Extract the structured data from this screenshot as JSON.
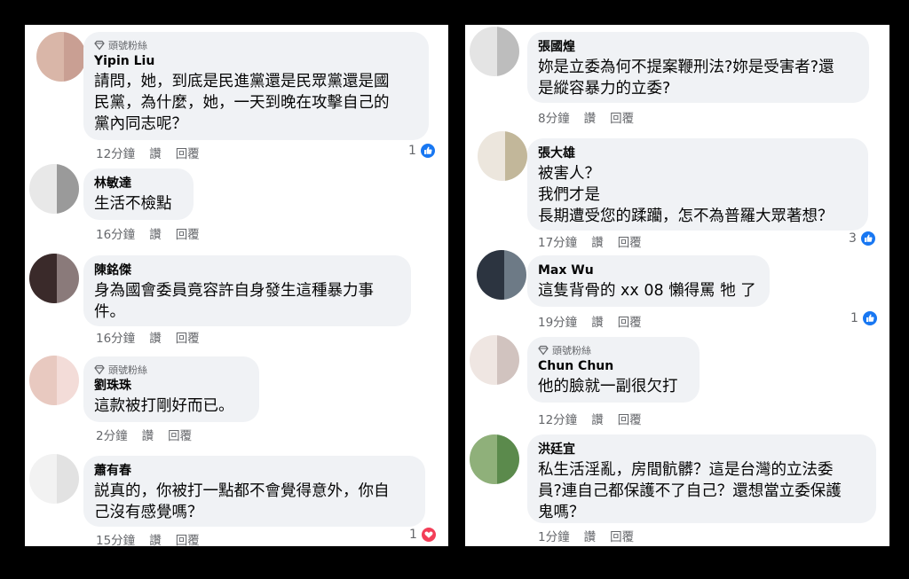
{
  "left_panel": {
    "comments": [
      {
        "badge": "頭號粉絲",
        "name": "Yipin Liu",
        "text": "請問，她，到底是民進黨還是民眾黨還是國\n民黨，為什麼，她，一天到晚在攻擊自己的\n黨內同志呢？",
        "time": "12分鐘",
        "like": "讚",
        "reply": "回覆",
        "reactions": "1",
        "reaction_type": "like"
      },
      {
        "badge": "",
        "name": "林敏達",
        "text": "生活不檢點",
        "time": "16分鐘",
        "like": "讚",
        "reply": "回覆",
        "reactions": "",
        "reaction_type": ""
      },
      {
        "badge": "",
        "name": "陳銘傑",
        "text": "身為國會委員竟容許自身發生這種暴力事\n件。",
        "time": "16分鐘",
        "like": "讚",
        "reply": "回覆",
        "reactions": "",
        "reaction_type": ""
      },
      {
        "badge": "頭號粉絲",
        "name": "劉珠珠",
        "text": "這款被打剛好而已。",
        "time": "2分鐘",
        "like": "讚",
        "reply": "回覆",
        "reactions": "",
        "reaction_type": ""
      },
      {
        "badge": "",
        "name": "蕭有春",
        "text": "説真的，你被打一點都不會覺得意外，你自\n己沒有感覺嗎？",
        "time": "15分鐘",
        "like": "讚",
        "reply": "回覆",
        "reactions": "1",
        "reaction_type": "love"
      }
    ]
  },
  "right_panel": {
    "comments": [
      {
        "badge": "",
        "name": "張國煌",
        "text": "妳是立委為何不提案鞭刑法?妳是受害者?還\n是縱容暴力的立委?",
        "time": "8分鐘",
        "like": "讚",
        "reply": "回覆",
        "reactions": "",
        "reaction_type": ""
      },
      {
        "badge": "",
        "name": "張大雄",
        "text": "被害人？\n我們才是\n長期遭受您的蹂躪，怎不為普羅大眾著想？",
        "time": "17分鐘",
        "like": "讚",
        "reply": "回覆",
        "reactions": "3",
        "reaction_type": "like"
      },
      {
        "badge": "",
        "name": "Max Wu",
        "text": "這隻背骨的 xx 08 懶得罵 牠 了",
        "time": "19分鐘",
        "like": "讚",
        "reply": "回覆",
        "reactions": "1",
        "reaction_type": "like"
      },
      {
        "badge": "頭號粉絲",
        "name": "Chun Chun",
        "text": "他的臉就一副很欠打",
        "time": "12分鐘",
        "like": "讚",
        "reply": "回覆",
        "reactions": "",
        "reaction_type": ""
      },
      {
        "badge": "",
        "name": "洪廷宜",
        "text": "私生活淫亂，房間骯髒？這是台灣的立法委\n員?連自己都保護不了自己？還想當立委保護\n鬼嗎？",
        "time": "1分鐘",
        "like": "讚",
        "reply": "回覆",
        "reactions": "",
        "reaction_type": ""
      }
    ]
  },
  "colors": {
    "like_blue": "#1877f2",
    "love_red": "#f33e58",
    "bubble_bg": "#f0f2f5",
    "meta_gray": "#65676b"
  },
  "icons": {
    "badge": "diamond-icon",
    "like": "thumbs-up-icon",
    "love": "heart-icon"
  }
}
